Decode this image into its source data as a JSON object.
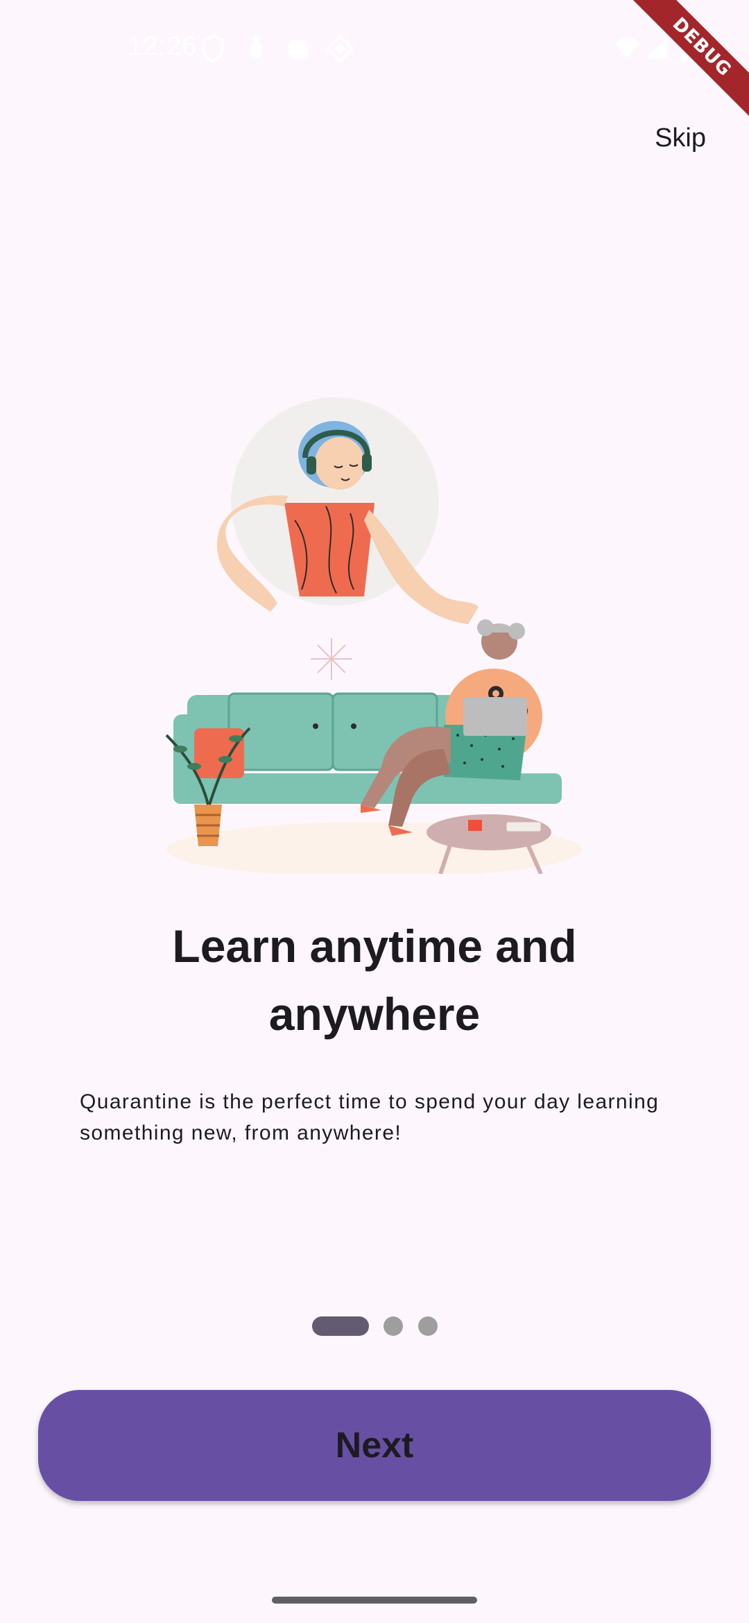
{
  "status_bar": {
    "time": "12:26",
    "icons": [
      "shield-icon",
      "bug-icon",
      "android-icon",
      "diamond-icon",
      "wifi-icon",
      "signal-icon",
      "battery-icon"
    ]
  },
  "debug_banner": {
    "label": "DEBUG",
    "color": "#a3262b"
  },
  "header": {
    "skip_label": "Skip"
  },
  "onboarding": {
    "title": "Learn anytime and anywhere",
    "description": "Quarantine is the perfect time to spend your day learning something new, from anywhere!",
    "illustration": "person-learning-illustration"
  },
  "page_indicator": {
    "total": 3,
    "active_index": 0,
    "active_color": "#625b71",
    "inactive_color": "#9e9e9e"
  },
  "footer": {
    "next_label": "Next",
    "button_color": "#6750a4"
  },
  "colors": {
    "background": "#fdf7fd",
    "text": "#1d1b20"
  }
}
